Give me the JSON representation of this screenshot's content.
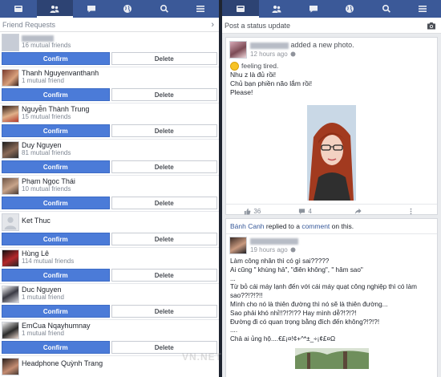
{
  "nav": {
    "left_tabs": [
      "news-feed",
      "friend-requests",
      "messages",
      "notifications",
      "search",
      "more"
    ],
    "right_tabs": [
      "news-feed",
      "friend-requests",
      "messages",
      "notifications",
      "search",
      "more"
    ]
  },
  "left": {
    "section_title": "Friend Requests",
    "chevron": "›",
    "confirm_label": "Confirm",
    "delete_label": "Delete",
    "requests": [
      {
        "name": "",
        "mutual": "16 mutual friends"
      },
      {
        "name": "Thanh Nguyenvanthanh",
        "mutual": "1 mutual friend"
      },
      {
        "name": "Nguyễn Thành Trung",
        "mutual": "15 mutual friends"
      },
      {
        "name": "Duy Nguyen",
        "mutual": "81 mutual friends"
      },
      {
        "name": "Phạm Ngọc Thái",
        "mutual": "10 mutual friends"
      },
      {
        "name": "Ket Thuc",
        "mutual": ""
      },
      {
        "name": "Hùng Lê",
        "mutual": "114 mutual friends"
      },
      {
        "name": "Duc Nguyen",
        "mutual": "1 mutual friend"
      },
      {
        "name": "EmCua Nqayhumnay",
        "mutual": "1 mutual friend"
      },
      {
        "name": "Headphone Quỳnh Trang",
        "mutual": ""
      }
    ]
  },
  "right": {
    "status_placeholder": "Post a status update",
    "post1": {
      "action": "added a new photo.",
      "time": "12 hours ago",
      "feeling": "feeling tired.",
      "line1": "Nhu z là đủ rồi!",
      "line2": "Chủ bạn phiền não lắm rồi!",
      "line3": "Please!",
      "likes": "36",
      "comments": "4"
    },
    "post2": {
      "actor": "Bánh Canh",
      "replied": " replied to a ",
      "comment_word": "comment",
      "on_this": " on this.",
      "time": "19 hours ago",
      "lines": [
        "Làm công nhân thì có gì sai?????",
        "Ai cũng \" khùng hả\", \"điên không\", \" hâm sao\"",
        "...",
        "Từ bỏ cái máy lạnh đến với cái máy quạt công nghiệp thì có làm sao??!?!?!!",
        "Mình cho nó là thiên đường thì nó sẽ là thiên đường...",
        "Sao phải khó nhỉ!!?!?!?? Hay mình dễ?!?!?!",
        "Đường đi có quan trọng bằng đích đến không?!?!?!",
        "....",
        "Chả ai ủng hộ....€£¡¤!¢+^*±_÷¡¢£¤Ω"
      ]
    }
  },
  "watermark": "VN.NET"
}
